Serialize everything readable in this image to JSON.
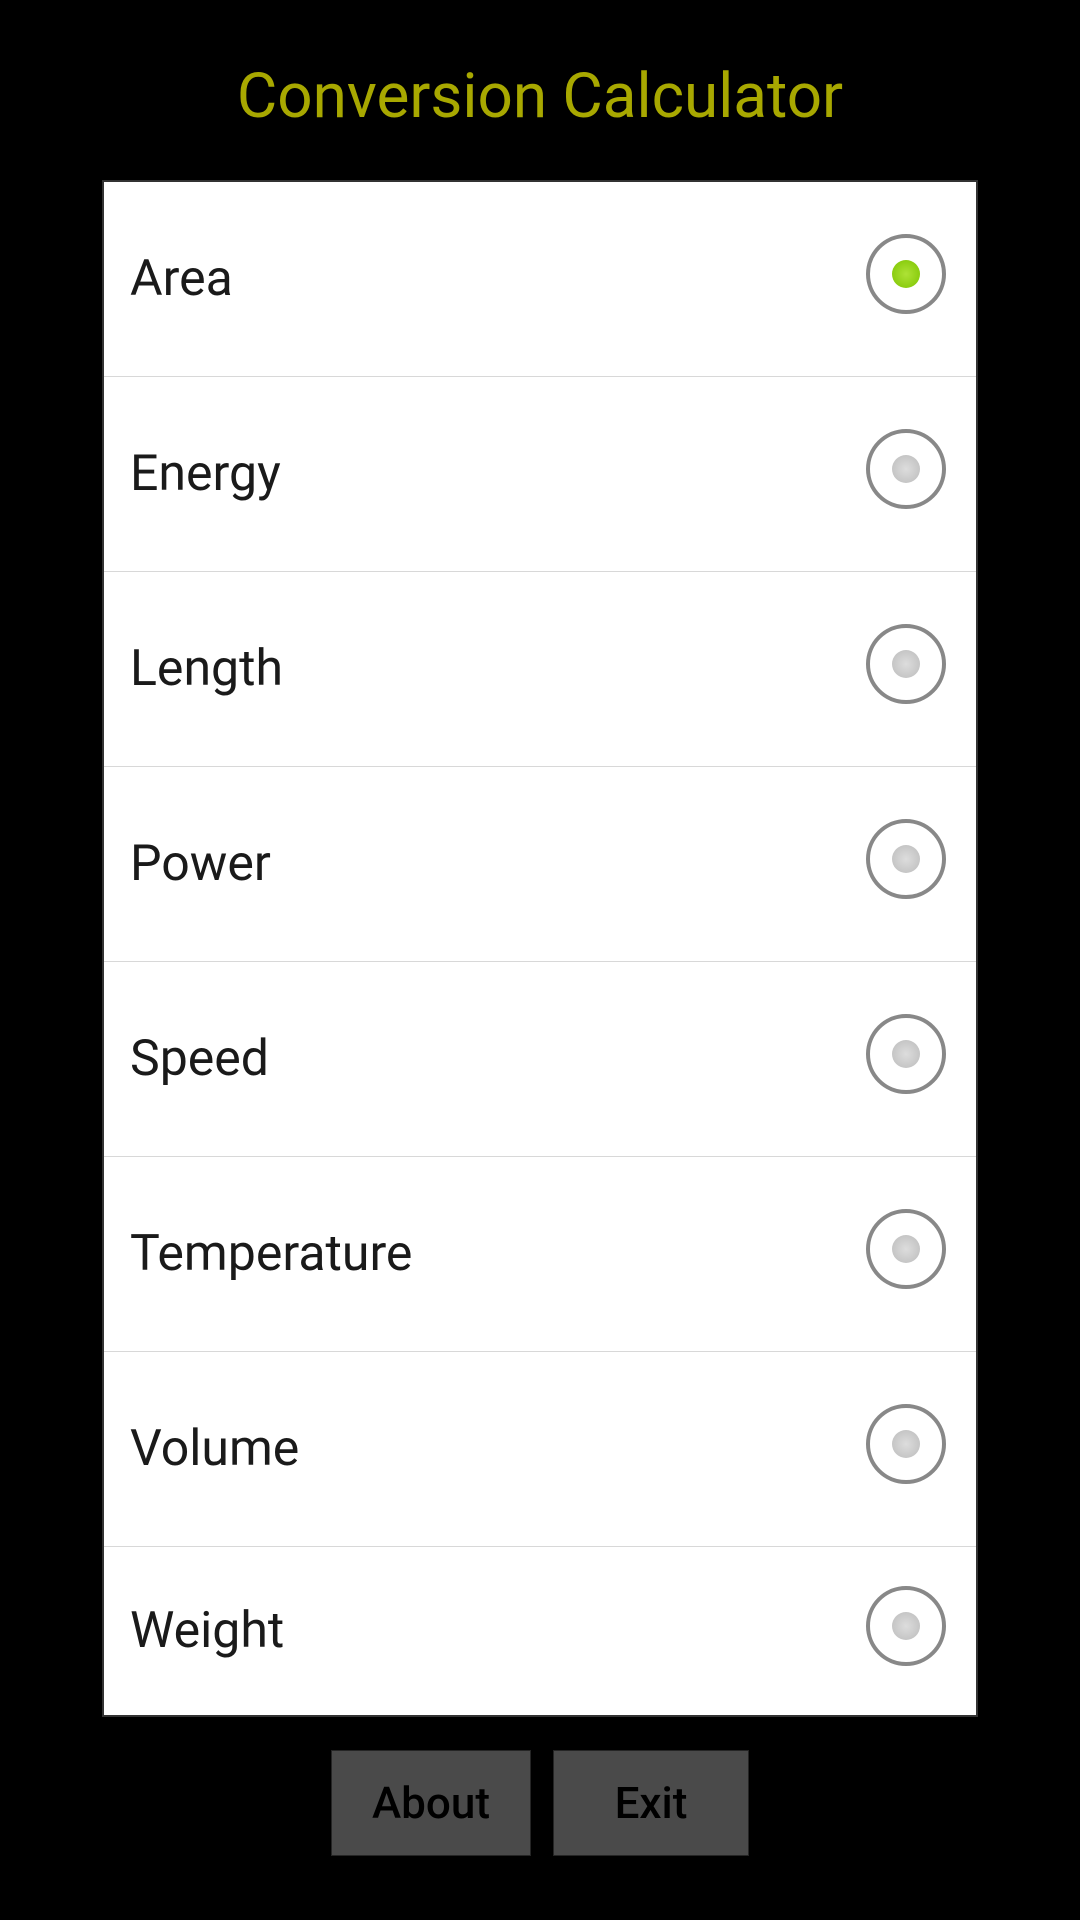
{
  "app": {
    "title": "Conversion Calculator"
  },
  "buttons": {
    "about": "About",
    "exit": "Exit"
  },
  "options": [
    {
      "label": "Area",
      "selected": true
    },
    {
      "label": "Energy",
      "selected": false
    },
    {
      "label": "Length",
      "selected": false
    },
    {
      "label": "Power",
      "selected": false
    },
    {
      "label": "Speed",
      "selected": false
    },
    {
      "label": "Temperature",
      "selected": false
    },
    {
      "label": "Volume",
      "selected": false
    },
    {
      "label": "Weight",
      "selected": false
    }
  ]
}
